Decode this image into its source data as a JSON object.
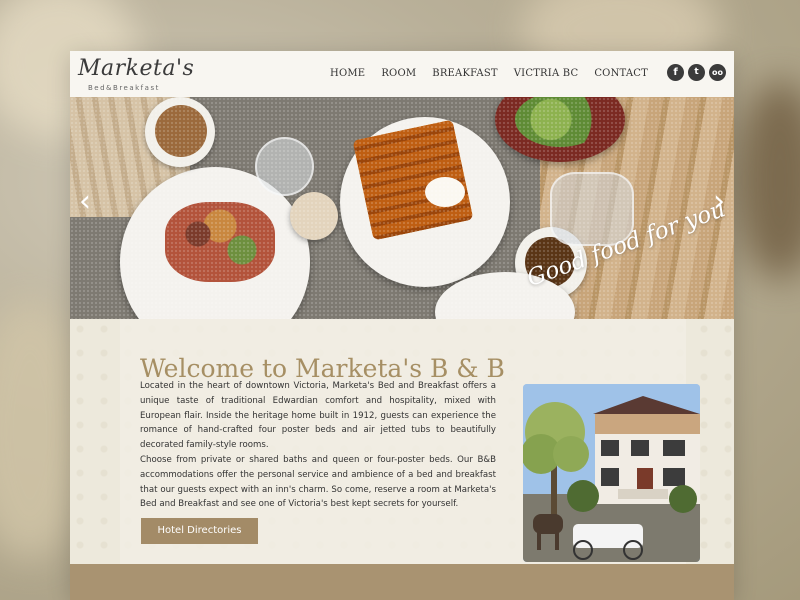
{
  "brand": {
    "name": "Marketa's",
    "subtitle": "Bed&Breakfast"
  },
  "nav": {
    "items": [
      "HOME",
      "ROOM",
      "BREAKFAST",
      "VICTRIA BC",
      "CONTACT"
    ]
  },
  "social": [
    {
      "icon": "facebook-icon",
      "glyph": "f"
    },
    {
      "icon": "twitter-icon",
      "glyph": "t"
    },
    {
      "icon": "tripadvisor-icon",
      "glyph": "oo"
    }
  ],
  "hero": {
    "slogan": "Good food for you",
    "prev_glyph": "‹",
    "next_glyph": "›"
  },
  "main": {
    "title": "Welcome to Marketa's B & B",
    "paragraph1": "Located in the heart of downtown Victoria, Marketa's Bed and Breakfast offers a unique taste of traditional Edwardian comfort and hospitality, mixed with European flair. Inside the heritage home built in 1912, guests can experience the romance of hand-crafted four poster beds and air jetted tubs to beautifully decorated family-style rooms.",
    "paragraph2": "Choose from private or shared baths and queen or four-poster beds. Our B&B accommodations offer the personal service and ambience of a bed and breakfast that our guests expect with an inn's charm. So come, reserve a room at Marketa's Bed and Breakfast and see one of Victoria's best kept secrets for yourself.",
    "button_label": "Hotel Directories"
  },
  "colors": {
    "accent": "#a38b67",
    "title": "#a68f64",
    "footer": "#a99371"
  }
}
